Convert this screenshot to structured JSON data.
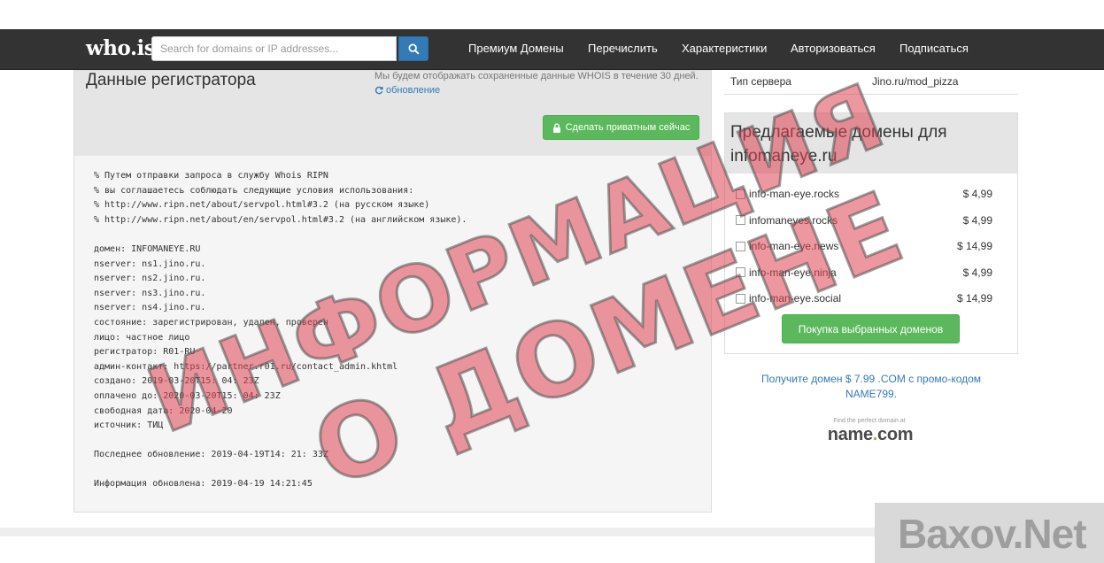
{
  "navbar": {
    "logo": "who.is",
    "search_placeholder": "Search for domains or IP addresses...",
    "links": [
      "Премиум Домены",
      "Перечислить",
      "Характеристики",
      "Авторизоваться",
      "Подписаться"
    ]
  },
  "registrar": {
    "title": "Данные регистратора",
    "cache_note": "Мы будем отображать сохраненные данные WHOIS в течение 30 дней.",
    "refresh_label": "обновление",
    "private_button": "Сделать приватным сейчас",
    "whois_lines": [
      "% Путем отправки запроса в службу Whois RIPN",
      "% вы соглашаетесь соблюдать следующие условия использования:",
      "% http://www.ripn.net/about/servpol.html#3.2 (на русском языке)",
      "% http://www.ripn.net/about/en/servpol.html#3.2 (на английском языке).",
      "",
      "домен: INFOMANEYE.RU",
      "nserver: ns1.jino.ru.",
      "nserver: ns2.jino.ru.",
      "nserver: ns3.jino.ru.",
      "nserver: ns4.jino.ru.",
      "состояние: зарегистрирован, удален, проверен",
      "лицо: частное лицо",
      "регистратор: R01-RU",
      "админ-контакт: https://partner.r01.ru/contact_admin.khtml",
      "создано: 2019-03-20T15: 04: 23Z",
      "оплачено до: 2020-03-20T15: 04: 23Z",
      "свободная дата: 2020-04-20",
      "источник: TИЦ",
      "",
      "Последнее обновление: 2019-04-19T14: 21: 33Z",
      "",
      "Информация обновлена: 2019-04-19 14:21:45"
    ]
  },
  "server": {
    "label": "Тип сервера",
    "value": "Jino.ru/mod_pizza"
  },
  "suggested": {
    "title": "Предлагаемые домены для infomaneye.ru",
    "domains": [
      {
        "name": "info-man-eye.rocks",
        "price": "$ 4,99"
      },
      {
        "name": "infomaneyes.rocks",
        "price": "$ 4,99"
      },
      {
        "name": "info-man-eye.news",
        "price": "$ 14,99"
      },
      {
        "name": "info-man-eye.ninja",
        "price": "$ 4,99"
      },
      {
        "name": "info-man-eye.social",
        "price": "$ 14,99"
      }
    ],
    "buy_button": "Покупка выбранных доменов"
  },
  "promo": {
    "text": "Получите домен $ 7.99 .COM с промо-кодом NAME799.",
    "tagline": "Find the perfect domain at",
    "logo_main": "name",
    "logo_dot": ".",
    "logo_tld": "com"
  },
  "stamp": {
    "line1": "ИНФОРМАЦИЯ",
    "line2": "О ДОМЕНЕ"
  },
  "site_watermark": "Baxov.Net",
  "colors": {
    "navbar": "#333333",
    "primary": "#337ab7",
    "success": "#5cb85c",
    "stamp": "#de4352"
  }
}
